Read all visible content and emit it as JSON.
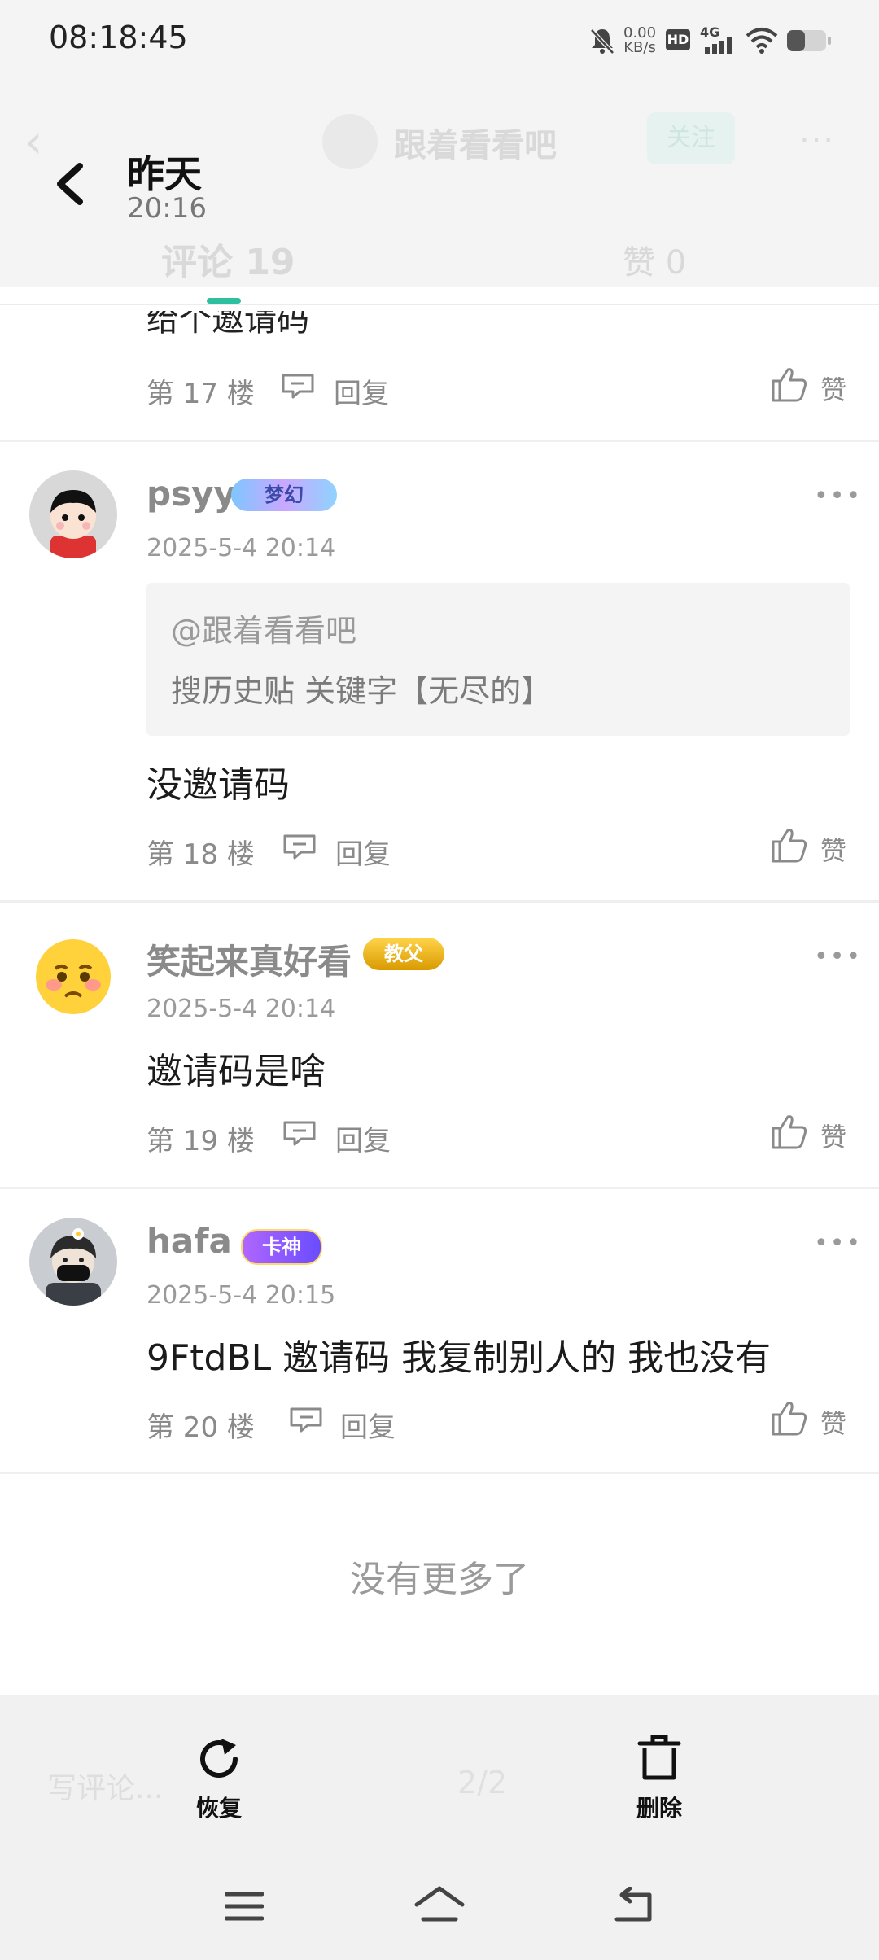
{
  "status_bar": {
    "time": "08:18:45",
    "net_speed": "0.00",
    "net_unit": "KB/s",
    "hd": "HD",
    "network": "4G"
  },
  "background_page": {
    "title": "跟着看看吧",
    "follow": "关注",
    "tab_comments": "评论 19",
    "tab_likes": "赞 0",
    "write_placeholder": "写评论...",
    "page_indicator": "2/2"
  },
  "header": {
    "day": "昨天",
    "time": "20:16"
  },
  "comments": [
    {
      "content": "给个邀请码",
      "floor": "第 17 楼",
      "reply": "回复",
      "like": "赞"
    },
    {
      "username": "psyy",
      "badge": "梦幻",
      "time": "2025-5-4 20:14",
      "quote_at": "@跟着看看吧",
      "quote_text": "搜历史贴 关键字【无尽的】",
      "content": "没邀请码",
      "floor": "第 18 楼",
      "reply": "回复",
      "like": "赞"
    },
    {
      "username": "笑起来真好看",
      "badge": "教父",
      "time": "2025-5-4 20:14",
      "content": "邀请码是啥",
      "floor": "第 19 楼",
      "reply": "回复",
      "like": "赞"
    },
    {
      "username": "hafa",
      "badge": "卡神",
      "time": "2025-5-4 20:15",
      "content": "9FtdBL 邀请码 我复制别人的 我也没有",
      "floor": "第 20 楼",
      "reply": "回复",
      "like": "赞"
    }
  ],
  "end_text": "没有更多了",
  "actions": {
    "restore": "恢复",
    "delete": "删除"
  },
  "colors": {
    "accent": "#2cbfa0",
    "muted": "#8a8a8a"
  }
}
